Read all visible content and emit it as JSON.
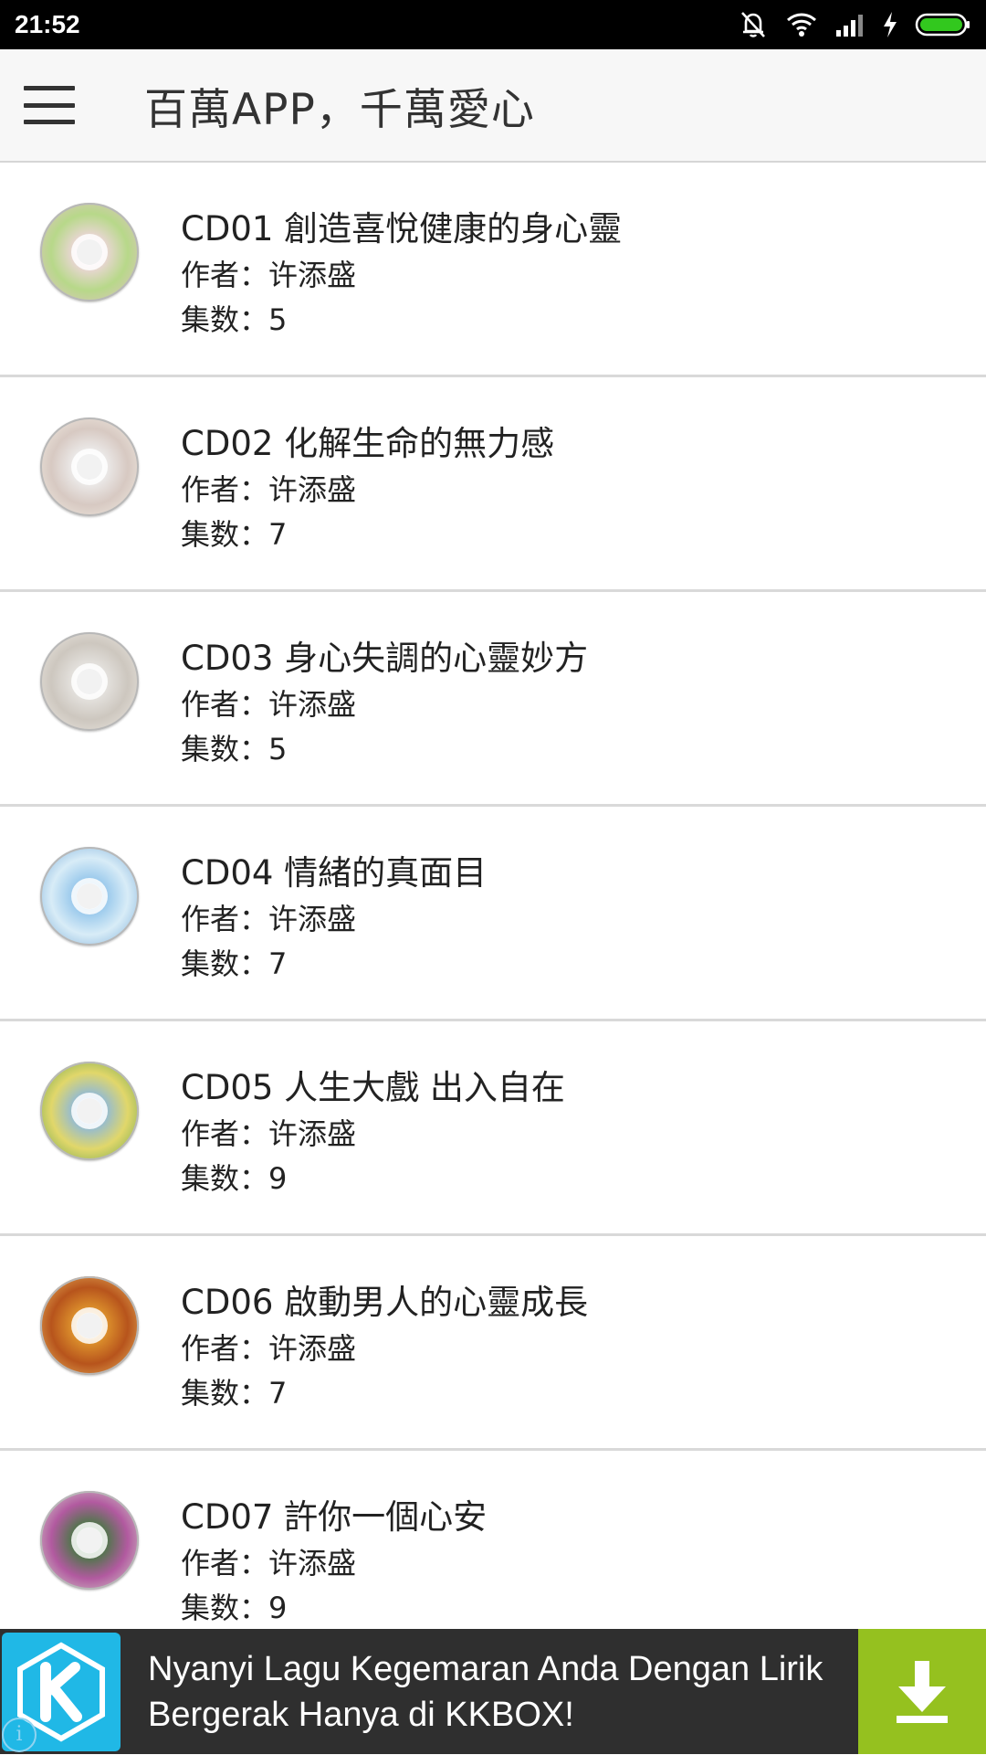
{
  "status_bar": {
    "time": "21:52",
    "icons": [
      "mute-icon",
      "wifi-icon",
      "signal-icon",
      "charging-icon",
      "battery-icon"
    ]
  },
  "app_bar": {
    "title": "百萬APP，千萬愛心",
    "menu_icon": "hamburger-menu-icon"
  },
  "items": [
    {
      "title": "CD01 創造喜悅健康的身心靈",
      "author": "作者：许添盛",
      "count": "集数：5",
      "colors": [
        "#f1d6df",
        "#b7d889",
        "#e9c0cf"
      ]
    },
    {
      "title": "CD02 化解生命的無力感",
      "author": "作者：许添盛",
      "count": "集数：7",
      "colors": [
        "#efefef",
        "#d7c9c2",
        "#f7f3e9"
      ]
    },
    {
      "title": "CD03 身心失調的心靈妙方",
      "author": "作者：许添盛",
      "count": "集数：5",
      "colors": [
        "#e8e6e3",
        "#cdc7bf",
        "#f2eee8"
      ]
    },
    {
      "title": "CD04 情緒的真面目",
      "author": "作者：许添盛",
      "count": "集数：7",
      "colors": [
        "#8fc3ea",
        "#d8ecf7",
        "#6fa6d6"
      ]
    },
    {
      "title": "CD05 人生大戲 出入自在",
      "author": "作者：许添盛",
      "count": "集数：9",
      "colors": [
        "#87b6e3",
        "#e1d76a",
        "#5d9f4b"
      ]
    },
    {
      "title": "CD06 啟動男人的心靈成長",
      "author": "作者：许添盛",
      "count": "集数：7",
      "colors": [
        "#e39b2f",
        "#b7541c",
        "#f1c66a"
      ]
    },
    {
      "title": "CD07 許你一個心安",
      "author": "作者：许添盛",
      "count": "集数：9",
      "colors": [
        "#3f7a3c",
        "#b25aa0",
        "#d9e9d0"
      ]
    }
  ],
  "ad": {
    "text": "Nyanyi Lagu Kegemaran Anda Dengan Lirik Bergerak Hanya di KKBOX!",
    "logo_icon": "kkbox-logo-icon",
    "download_icon": "download-icon",
    "info_icon": "info-icon"
  }
}
